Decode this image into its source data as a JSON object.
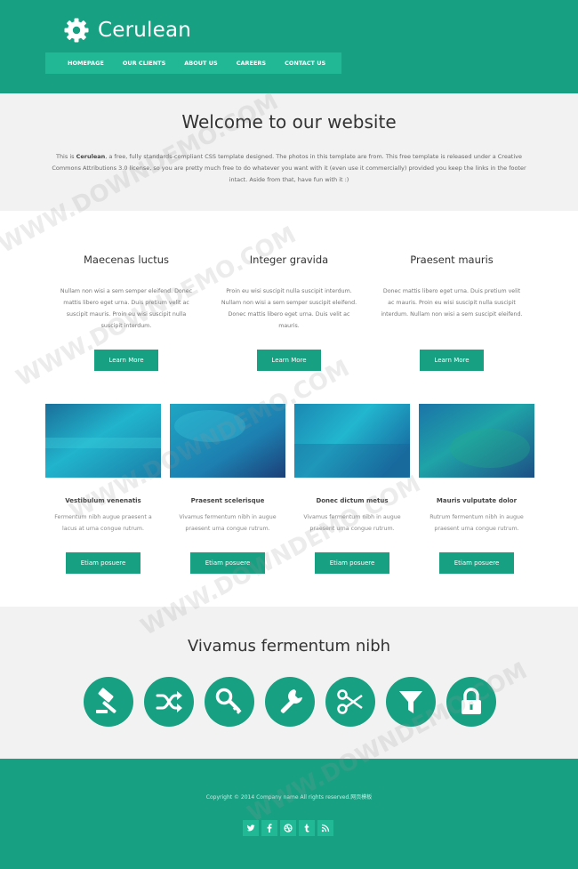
{
  "brand": {
    "name": "Cerulean",
    "logo_icon": "gear-icon",
    "accent_color": "#18a083",
    "nav_color": "#21b896"
  },
  "nav": {
    "items": [
      {
        "label": "HOMEPAGE"
      },
      {
        "label": "OUR CLIENTS"
      },
      {
        "label": "ABOUT US"
      },
      {
        "label": "CAREERS"
      },
      {
        "label": "CONTACT US"
      }
    ]
  },
  "welcome": {
    "title": "Welcome to our website",
    "text_before": "This is ",
    "text_bold": "Cerulean",
    "text_after": ", a free, fully standards-compliant CSS template designed. The photos in this template are from. This free template is released under a Creative Commons Attributions 3.0 license, so you are pretty much free to do whatever you want with it (even use it commercially) provided you keep the links in the footer intact. Aside from that, have fun with it :)"
  },
  "columns": [
    {
      "title": "Maecenas luctus",
      "text": "Nullam non wisi a sem semper eleifend. Donec mattis libero eget urna. Duis pretium velit ac suscipit mauris. Proin eu wisi suscipit nulla suscipit interdum.",
      "button": "Learn More"
    },
    {
      "title": "Integer gravida",
      "text": "Proin eu wisi suscipit nulla suscipit interdum. Nullam non wisi a sem semper suscipit eleifend. Donec mattis libero eget urna. Duis velit ac mauris.",
      "button": "Learn More"
    },
    {
      "title": "Praesent mauris",
      "text": "Donec mattis libero eget urna. Duis pretium velit ac mauris. Proin eu wisi suscipit nulla suscipit interdum. Nullam non wisi a sem suscipit eleifend.",
      "button": "Learn More"
    }
  ],
  "cards": [
    {
      "title": "Vestibulum venenatis",
      "text": "Fermentum nibh augue praesent a lacus at urna congue rutrum.",
      "button": "Etiam posuere"
    },
    {
      "title": "Praesent scelerisque",
      "text": "Vivamus fermentum nibh in augue praesent urna congue rutrum.",
      "button": "Etiam posuere"
    },
    {
      "title": "Donec dictum metus",
      "text": "Vivamus fermentum nibh in augue praesent urna congue rutrum.",
      "button": "Etiam posuere"
    },
    {
      "title": "Mauris vulputate dolor",
      "text": "Rutrum fermentum nibh in augue praesent urna congue rutrum.",
      "button": "Etiam posuere"
    }
  ],
  "icons_section": {
    "title": "Vivamus fermentum nibh",
    "icons": [
      "gavel-icon",
      "shuffle-icon",
      "key-icon",
      "wrench-icon",
      "scissors-icon",
      "filter-icon",
      "lock-icon"
    ]
  },
  "footer": {
    "copyright": "Copyright © 2014 Company name All rights reserved.网页模板",
    "social_icons": [
      "twitter-icon",
      "facebook-icon",
      "dribbble-icon",
      "tumblr-icon",
      "rss-icon"
    ]
  },
  "watermark": "WWW.DOWNDEMO.COM"
}
